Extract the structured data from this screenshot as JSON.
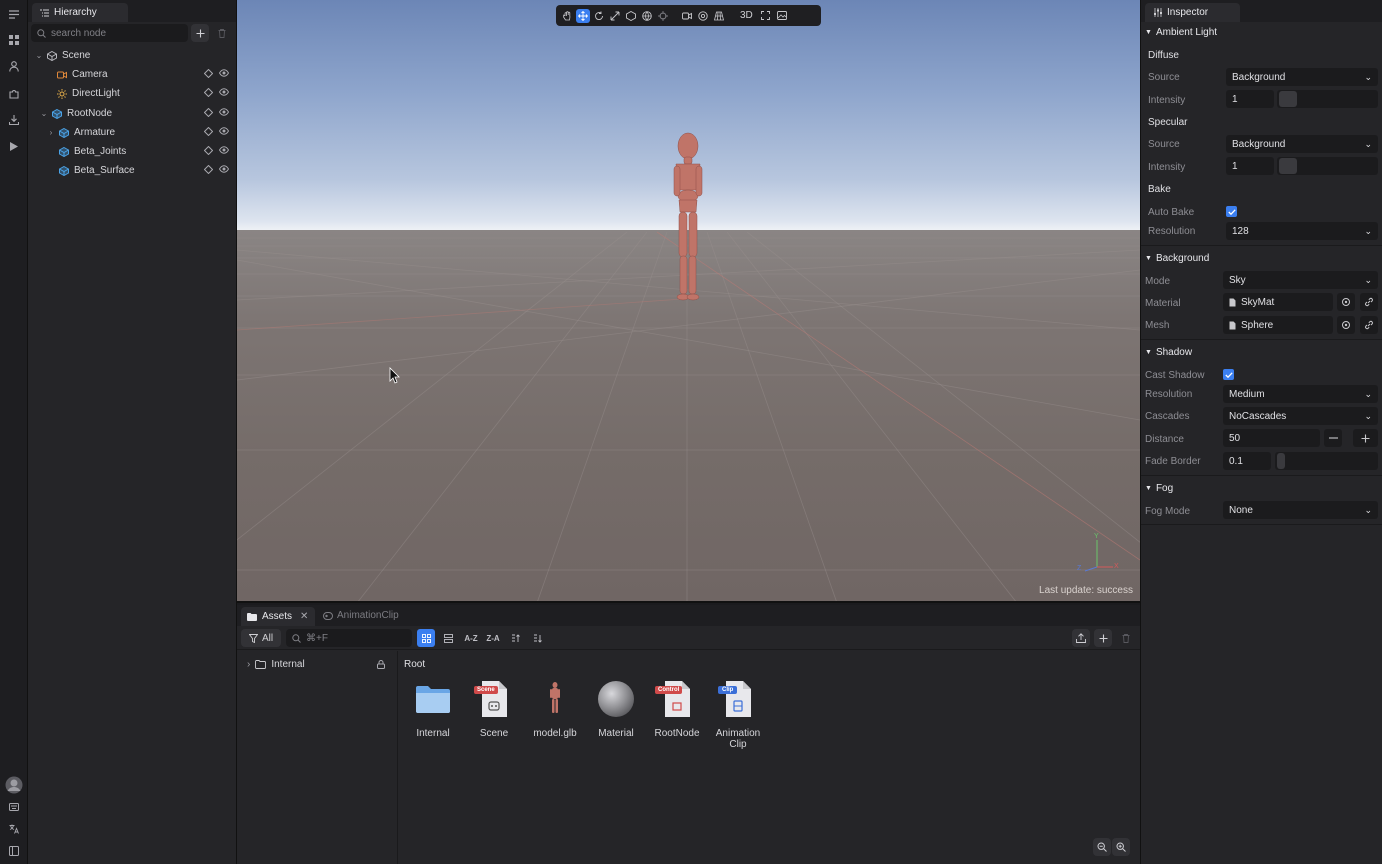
{
  "hierarchy": {
    "tab_label": "Hierarchy",
    "search_placeholder": "search node",
    "nodes": [
      {
        "label": "Scene",
        "icon": "scene-icon",
        "expanded": true
      },
      {
        "label": "Camera",
        "icon": "camera-icon",
        "color": "#e0883a"
      },
      {
        "label": "DirectLight",
        "icon": "light-icon",
        "color": "#e8b04a"
      },
      {
        "label": "RootNode",
        "icon": "cube-icon",
        "color": "#4aa3e8",
        "expanded": true
      },
      {
        "label": "Armature",
        "icon": "cube-icon",
        "color": "#4aa3e8",
        "expanded": false
      },
      {
        "label": "Beta_Joints",
        "icon": "cube-icon",
        "color": "#4aa3e8"
      },
      {
        "label": "Beta_Surface",
        "icon": "cube-icon",
        "color": "#4aa3e8"
      }
    ]
  },
  "viewport": {
    "toolbar_mode": "3D",
    "status": "Last update: success",
    "axis_labels": {
      "y": "Y",
      "x": "X",
      "z": "Z"
    }
  },
  "assets": {
    "tabs": [
      "Assets",
      "AnimationClip"
    ],
    "filter_label": "All",
    "search_placeholder": "⌘+F",
    "sort_az": "A-Z",
    "sort_za": "Z-A",
    "tree": [
      {
        "label": "Internal"
      }
    ],
    "breadcrumb": "Root",
    "items": [
      {
        "label": "Internal",
        "kind": "folder"
      },
      {
        "label": "Scene",
        "kind": "scene",
        "badge": "Scene",
        "badge_color": "#d04a4a"
      },
      {
        "label": "model.glb",
        "kind": "model"
      },
      {
        "label": "Material",
        "kind": "material"
      },
      {
        "label": "RootNode",
        "kind": "prefab",
        "badge": "Control",
        "badge_color": "#d04a4a"
      },
      {
        "label": "Animation Clip",
        "kind": "clip",
        "badge": "Clip",
        "badge_color": "#3b6fd8"
      }
    ]
  },
  "inspector": {
    "tab_label": "Inspector",
    "ambient": {
      "title": "Ambient Light",
      "diffuse": {
        "title": "Diffuse",
        "source_label": "Source",
        "source": "Background",
        "intensity_label": "Intensity",
        "intensity": "1"
      },
      "specular": {
        "title": "Specular",
        "source_label": "Source",
        "source": "Background",
        "intensity_label": "Intensity",
        "intensity": "1"
      },
      "bake": {
        "title": "Bake",
        "auto_label": "Auto Bake",
        "auto": true,
        "resolution_label": "Resolution",
        "resolution": "128"
      }
    },
    "background": {
      "title": "Background",
      "mode_label": "Mode",
      "mode": "Sky",
      "material_label": "Material",
      "material": "SkyMat",
      "mesh_label": "Mesh",
      "mesh": "Sphere"
    },
    "shadow": {
      "title": "Shadow",
      "cast_label": "Cast Shadow",
      "cast": true,
      "resolution_label": "Resolution",
      "resolution": "Medium",
      "cascades_label": "Cascades",
      "cascades": "NoCascades",
      "distance_label": "Distance",
      "distance": "50",
      "fade_label": "Fade Border",
      "fade": "0.1"
    },
    "fog": {
      "title": "Fog",
      "mode_label": "Fog Mode",
      "mode": "None"
    }
  },
  "colors": {
    "accent": "#3b7ff0",
    "panel": "#252528",
    "input": "#1b1b1d"
  }
}
